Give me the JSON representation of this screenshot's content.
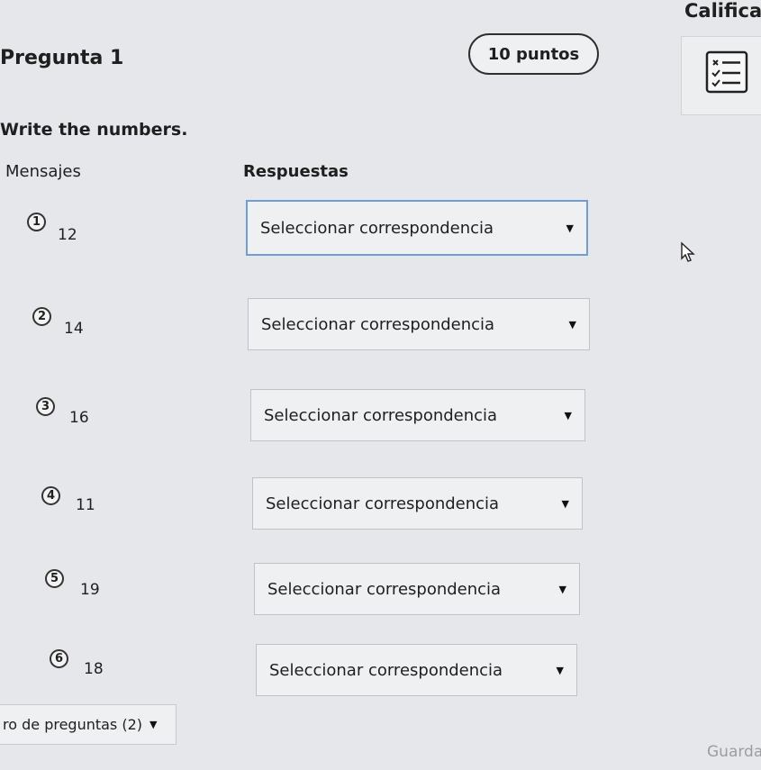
{
  "header": {
    "grade_label": "Calificac",
    "question_title": "Pregunta 1",
    "points": "10 puntos",
    "rubric_icon": "checklist-icon"
  },
  "question": {
    "instructions": "Write the numbers.",
    "col_messages": "Mensajes",
    "col_answers": "Respuestas",
    "rows": [
      {
        "num": "1",
        "value": "12",
        "select": "Seleccionar correspondencia"
      },
      {
        "num": "2",
        "value": "14",
        "select": "Seleccionar correspondencia"
      },
      {
        "num": "3",
        "value": "16",
        "select": "Seleccionar correspondencia"
      },
      {
        "num": "4",
        "value": "11",
        "select": "Seleccionar correspondencia"
      },
      {
        "num": "5",
        "value": "19",
        "select": "Seleccionar correspondencia"
      },
      {
        "num": "6",
        "value": "18",
        "select": "Seleccionar correspondencia"
      }
    ]
  },
  "footer": {
    "question_nav": "ro de preguntas (2)",
    "save_label": "Guarda"
  }
}
